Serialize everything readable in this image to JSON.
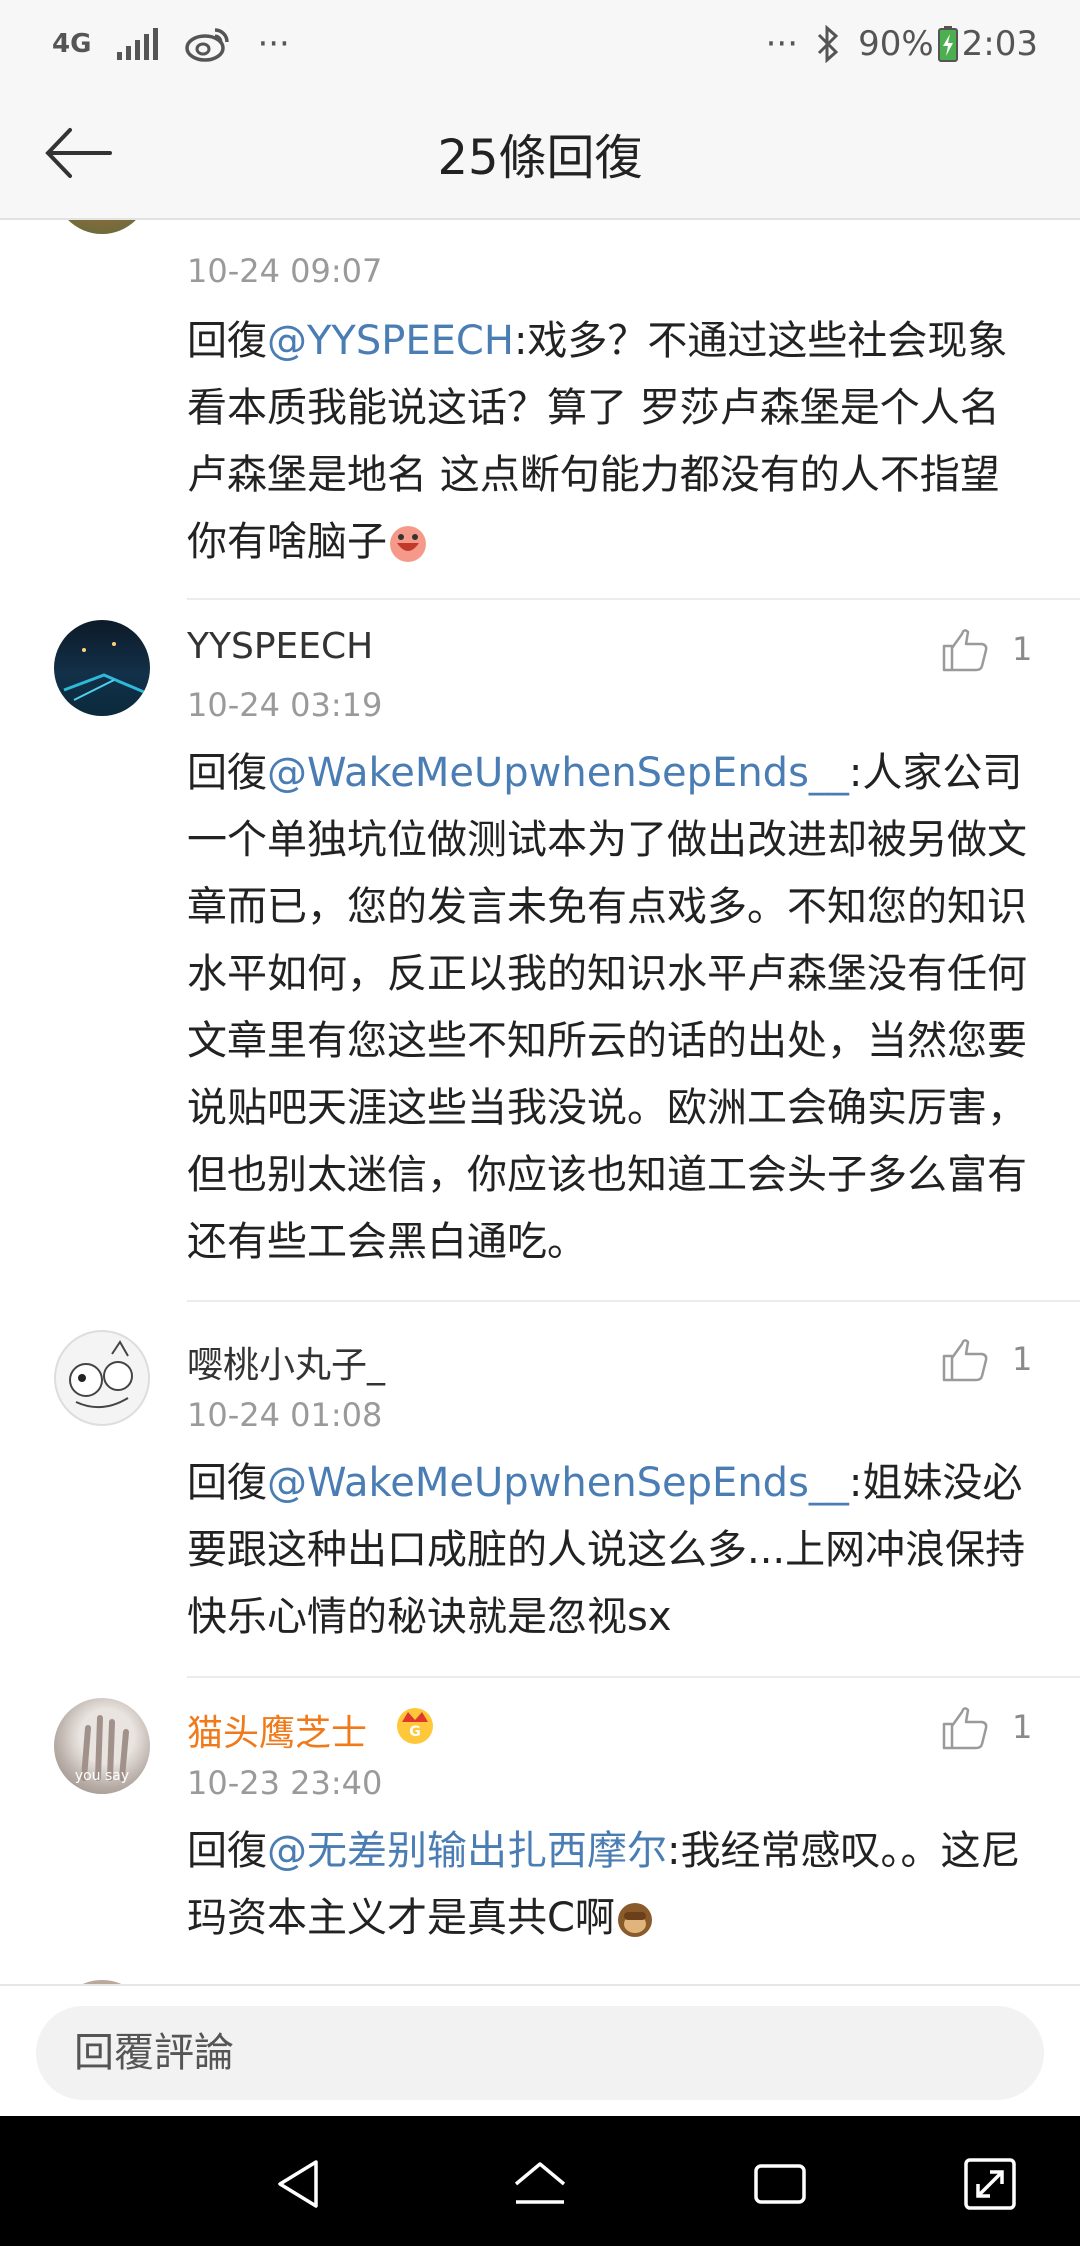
{
  "status": {
    "network": "4G",
    "more_left": "···",
    "more_right": "···",
    "battery": "90%",
    "time": "2:03"
  },
  "header": {
    "title": "25條回復"
  },
  "comments": [
    {
      "time": "10-24 09:07",
      "prefix": "回復",
      "mention": "@YYSPEECH",
      "text": ":戏多？不通过这些社会现象看本质我能说这话？算了 罗莎卢森堡是个人名卢森堡是地名 这点断句能力都没有的人不指望你有啥脑子"
    },
    {
      "username": "YYSPEECH",
      "time": "10-24 03:19",
      "likes": "1",
      "prefix": "回復",
      "mention": "@WakeMeUpwhenSepEnds__",
      "text": ":人家公司一个单独坑位做测试本为了做出改进却被另做文章而已，您的发言未免有点戏多。不知您的知识水平如何，反正以我的知识水平卢森堡没有任何文章里有您这些不知所云的话的出处，当然您要说贴吧天涯这些当我没说。欧洲工会确实厉害，但也别太迷信，你应该也知道工会头子多么富有还有些工会黑白通吃。"
    },
    {
      "username": "嘤桃小丸子_",
      "time": "10-24 01:08",
      "likes": "1",
      "prefix": "回復",
      "mention": "@WakeMeUpwhenSepEnds__",
      "text": ":姐妹没必要跟这种出口成脏的人说这么多...上网冲浪保持快乐心情的秘诀就是忽视sx"
    },
    {
      "username": "猫头鹰芝士",
      "time": "10-23 23:40",
      "likes": "1",
      "prefix": "回復",
      "mention": "@无差别输出扎西摩尔",
      "text": ":我经常感叹。。这尼玛资本主义才是真共C啊",
      "avatar_caption": "you say"
    }
  ],
  "reply": {
    "placeholder": "回覆評論"
  },
  "colors": {
    "mention": "#4a7db3",
    "vip_name": "#f07a1a",
    "meta": "#9a9a9a"
  },
  "icons": [
    "back-arrow-icon",
    "thumb-up-icon",
    "nav-back-icon",
    "nav-home-icon",
    "nav-recents-icon",
    "nav-expand-icon"
  ]
}
